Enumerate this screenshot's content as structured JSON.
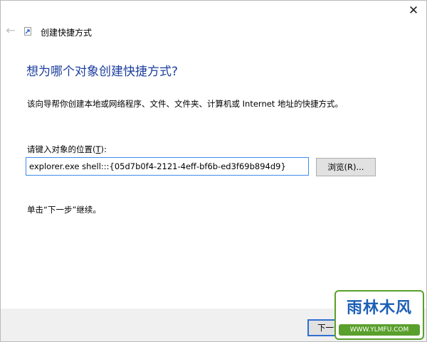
{
  "window": {
    "title": "创建快捷方式",
    "close_glyph": "✕",
    "back_glyph": "←"
  },
  "wizard": {
    "heading": "想为哪个对象创建快捷方式?",
    "description": "该向导帮你创建本地或网络程序、文件、文件夹、计算机或 Internet 地址的快捷方式。",
    "location_label_prefix": "请键入对象的位置(",
    "location_label_key": "T",
    "location_label_suffix": "):",
    "location_value": "explorer.exe shell:::{05d7b0f4-2121-4eff-bf6b-ed3f69b894d9}",
    "browse_label": "浏览(R)...",
    "hint": "单击“下一步”继续。"
  },
  "footer": {
    "next_label": "下一步(N)"
  },
  "watermark": {
    "logo_text": "雨林木风",
    "url": "WWW.YLMFU.COM"
  },
  "colors": {
    "heading": "#1c3e9e",
    "input_border": "#3d8ee8",
    "footer_bg": "#f0f0f0",
    "watermark_green": "#5aa02c",
    "watermark_blue": "#1d5fb6"
  },
  "icons": {
    "back": "arrow-left-icon",
    "shortcut": "shortcut-icon",
    "close": "close-icon"
  }
}
